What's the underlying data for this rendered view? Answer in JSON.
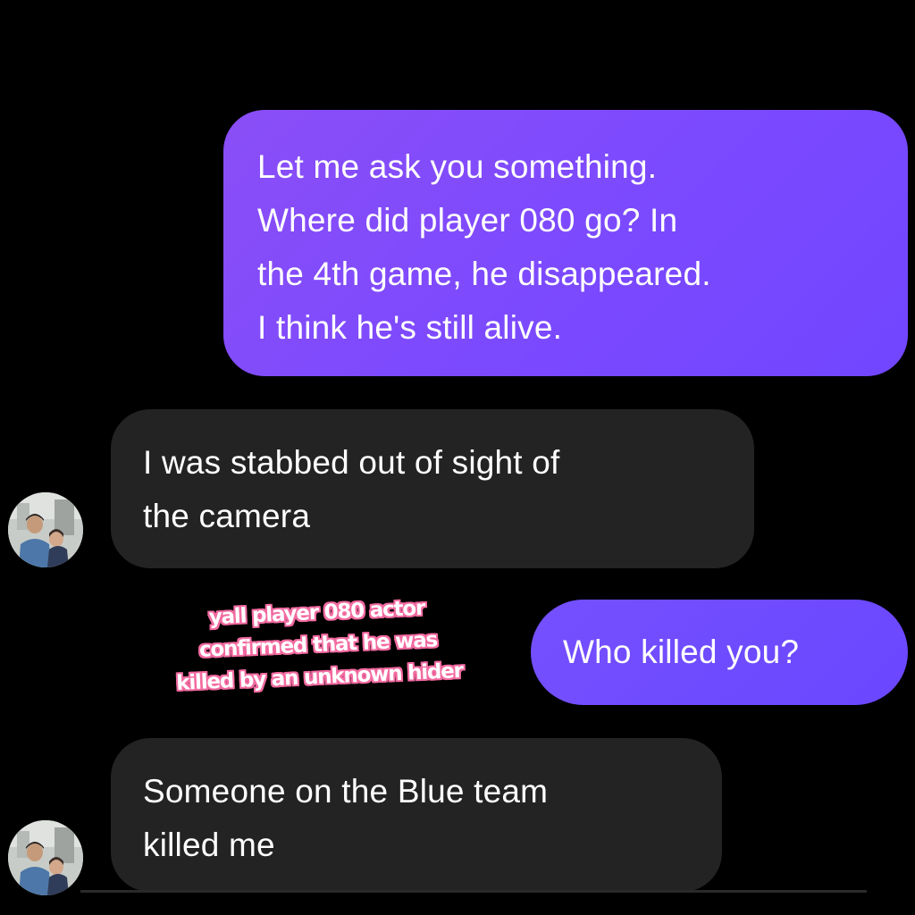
{
  "chat": {
    "messages": [
      {
        "sender": "me",
        "text": "Let me ask you something.\nWhere did player 080 go? In\nthe 4th game, he disappeared.\nI think he's still alive."
      },
      {
        "sender": "other",
        "text": "I was stabbed out of sight of\nthe camera"
      },
      {
        "sender": "me",
        "text": "Who killed you?"
      },
      {
        "sender": "other",
        "text": "Someone on the Blue team\nkilled me"
      }
    ],
    "avatar_icon": "profile-photo-avatar"
  },
  "overlay": {
    "caption_lines": [
      "yall player 080 actor",
      "confirmed that he was",
      "killed by an unknown hider"
    ],
    "caption_color": "#ffffff",
    "caption_outline_color": "#f26aa0"
  },
  "colors": {
    "background": "#000000",
    "sent_bubble": "#7c4bff",
    "received_bubble": "#232323",
    "text": "#ffffff"
  }
}
